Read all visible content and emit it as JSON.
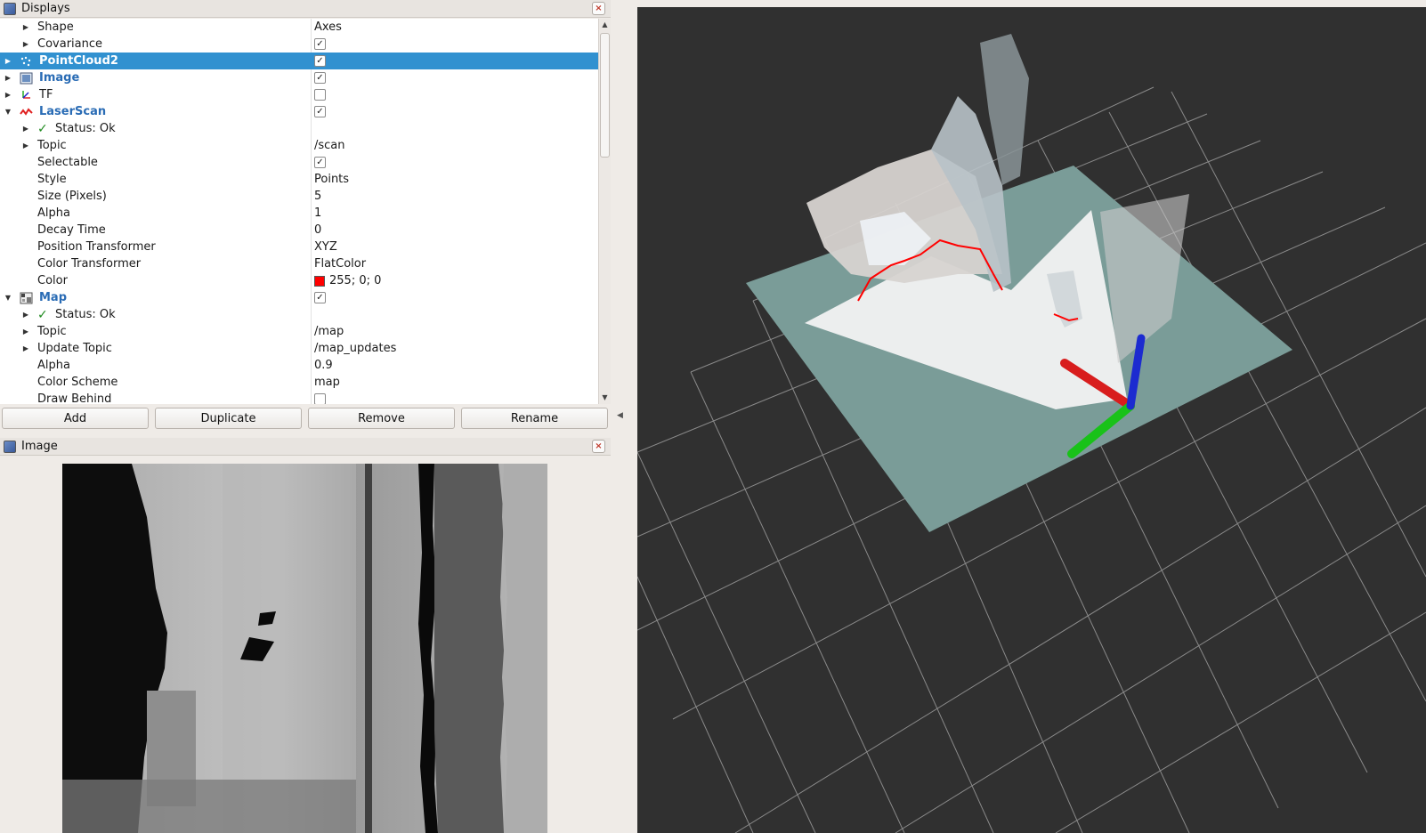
{
  "displays_panel": {
    "title": "Displays",
    "close_glyph": "×",
    "rows": [
      {
        "label": "Shape",
        "value": "Axes",
        "top": false
      },
      {
        "label": "Covariance",
        "value": "",
        "check": true,
        "top": false
      },
      {
        "label": "PointCloud2",
        "value": "",
        "check": true,
        "top": true,
        "selected": true,
        "icon": "pointcloud-icon"
      },
      {
        "label": "Image",
        "value": "",
        "check": true,
        "top": true,
        "icon": "image-icon"
      },
      {
        "label": "TF",
        "value": "",
        "check": false,
        "top": false,
        "icon": "tf-icon"
      },
      {
        "label": "LaserScan",
        "value": "",
        "check": true,
        "top": true,
        "icon": "laserscan-icon"
      },
      {
        "label": "Status: Ok",
        "value": "",
        "top": false
      },
      {
        "label": "Topic",
        "value": "/scan",
        "top": false
      },
      {
        "label": "Selectable",
        "value": "",
        "check": true,
        "top": false
      },
      {
        "label": "Style",
        "value": "Points",
        "top": false
      },
      {
        "label": "Size (Pixels)",
        "value": "5",
        "top": false
      },
      {
        "label": "Alpha",
        "value": "1",
        "top": false
      },
      {
        "label": "Decay Time",
        "value": "0",
        "top": false
      },
      {
        "label": "Position Transformer",
        "value": "XYZ",
        "top": false
      },
      {
        "label": "Color Transformer",
        "value": "FlatColor",
        "top": false
      },
      {
        "label": "Color",
        "value": "255; 0; 0",
        "top": false
      },
      {
        "label": "Map",
        "value": "",
        "check": true,
        "top": true,
        "icon": "map-icon"
      },
      {
        "label": "Status: Ok",
        "value": "",
        "top": false
      },
      {
        "label": "Topic",
        "value": "/map",
        "top": false
      },
      {
        "label": "Update Topic",
        "value": "/map_updates",
        "top": false
      },
      {
        "label": "Alpha",
        "value": "0.9",
        "top": false
      },
      {
        "label": "Color Scheme",
        "value": "map",
        "top": false
      },
      {
        "label": "Draw Behind",
        "value": "",
        "check": false,
        "top": false
      }
    ]
  },
  "buttons": {
    "add": "Add",
    "duplicate": "Duplicate",
    "remove": "Remove",
    "rename": "Rename"
  },
  "image_panel": {
    "title": "Image",
    "close_glyph": "×"
  },
  "colors": {
    "selection": "#3191d0",
    "laser_color": "#ff0000",
    "view_bg": "#303030",
    "map_plane": "#7a9c98"
  },
  "check_glyph": "✓"
}
